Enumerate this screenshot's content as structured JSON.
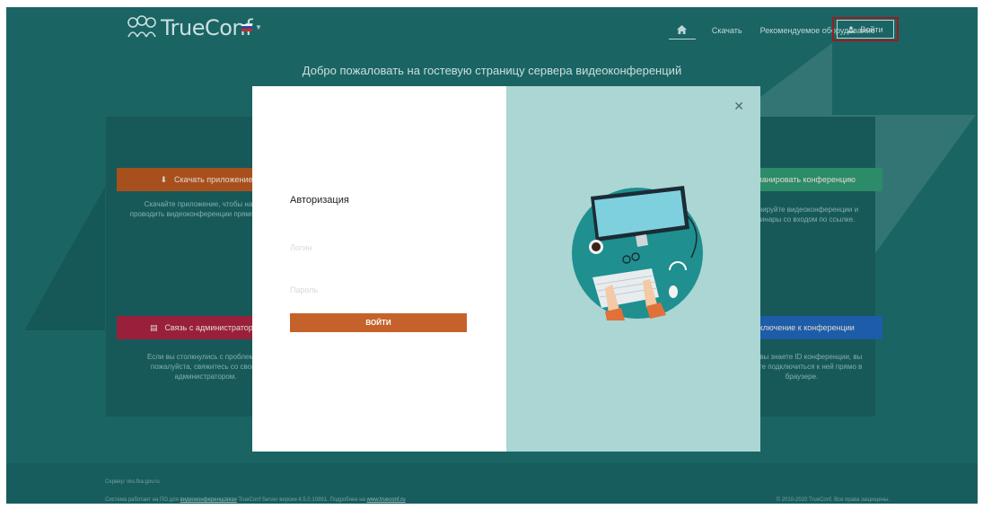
{
  "header": {
    "logo_text": "TrueConf",
    "language": {
      "flag_colors": [
        "#ffffff",
        "#2b4fb0",
        "#d32f2f"
      ]
    },
    "nav": {
      "home_icon": "home-icon",
      "download_label": "Скачать",
      "hardware_label": "Рекомендуемое оборудование",
      "login_label": "Войти"
    },
    "welcome": "Добро пожаловать на гостевую страницу сервера видеоконференций"
  },
  "background_cards": {
    "download_app": {
      "label": "Скачать приложение",
      "color": "#b3561f",
      "desc": "Скачайте приложение, чтобы начать проводить видеоконференции прямо сейчас."
    },
    "schedule": {
      "label": "Запланировать конференцию",
      "color": "#2f9470",
      "desc": "Планируйте видеоконференции и вебинары со входом по ссылке."
    },
    "contact_admin": {
      "label": "Связь с администратором",
      "color": "#a3223e",
      "desc": "Если вы столкнулись с проблемой, пожалуйста, свяжитесь со своим администратором."
    },
    "join": {
      "label": "Подключение к конференции",
      "color": "#1f62b3",
      "desc": "Если вы знаете ID конференции, вы можете подключиться к ней прямо в браузере."
    }
  },
  "footer": {
    "server_label": "Сервер: vks.fka.gov.ru",
    "notice_prefix": "Система работает на ПО для",
    "notice_link": "видеоконференцсвязи",
    "notice_middle": "TrueConf Server версии 4.5.0.10891. Подробнее на",
    "notice_site": "www.trueconf.ru",
    "copyright": "© 2010-2020 TrueConf. Все права защищены."
  },
  "modal": {
    "title": "Авторизация",
    "login_placeholder": "Логин",
    "password_placeholder": "Пароль",
    "submit_label": "ВОЙТИ",
    "close_icon": "close-icon",
    "illustration": "workspace-illustration"
  }
}
